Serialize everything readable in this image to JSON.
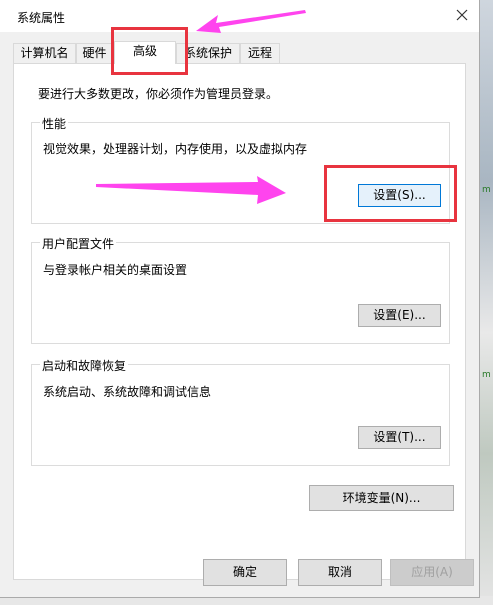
{
  "window": {
    "title": "系统属性"
  },
  "tabs": [
    {
      "label": "计算机名"
    },
    {
      "label": "硬件"
    },
    {
      "label": "高级",
      "active": true
    },
    {
      "label": "系统保护"
    },
    {
      "label": "远程"
    }
  ],
  "advanced": {
    "admin_note": "要进行大多数更改，你必须作为管理员登录。",
    "performance": {
      "title": "性能",
      "description": "视觉效果，处理器计划，内存使用，以及虚拟内存",
      "button": "设置(S)..."
    },
    "user_profiles": {
      "title": "用户配置文件",
      "description": "与登录帐户相关的桌面设置",
      "button": "设置(E)..."
    },
    "startup_recovery": {
      "title": "启动和故障恢复",
      "description": "系统启动、系统故障和调试信息",
      "button": "设置(T)..."
    },
    "env_vars_button": "环境变量(N)..."
  },
  "footer": {
    "ok": "确定",
    "cancel": "取消",
    "apply": "应用(A)"
  },
  "annotations": {
    "color": "#e8343f",
    "arrow_color": "#ff44ee"
  },
  "icons": {
    "close": "close-icon"
  }
}
